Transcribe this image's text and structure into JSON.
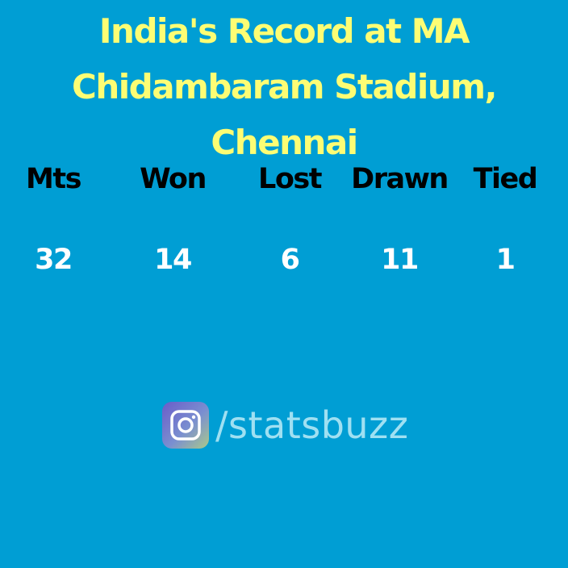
{
  "title": {
    "line1": "India's Record at MA",
    "line2": "Chidambaram Stadium,",
    "line3": "Chennai"
  },
  "stats": {
    "headers": [
      "Mts",
      "Won",
      "Lost",
      "Drawn",
      "Tied"
    ],
    "values": [
      "32",
      "14",
      "6",
      "11",
      "1"
    ]
  },
  "brand": {
    "icon": "instagram-icon",
    "handle": "/statsbuzz"
  },
  "colors": {
    "background": "#009ed4",
    "title": "#fdfd74",
    "header_text": "#000000",
    "value_text": "#ffffff",
    "handle_text": "#9fe0f2"
  }
}
